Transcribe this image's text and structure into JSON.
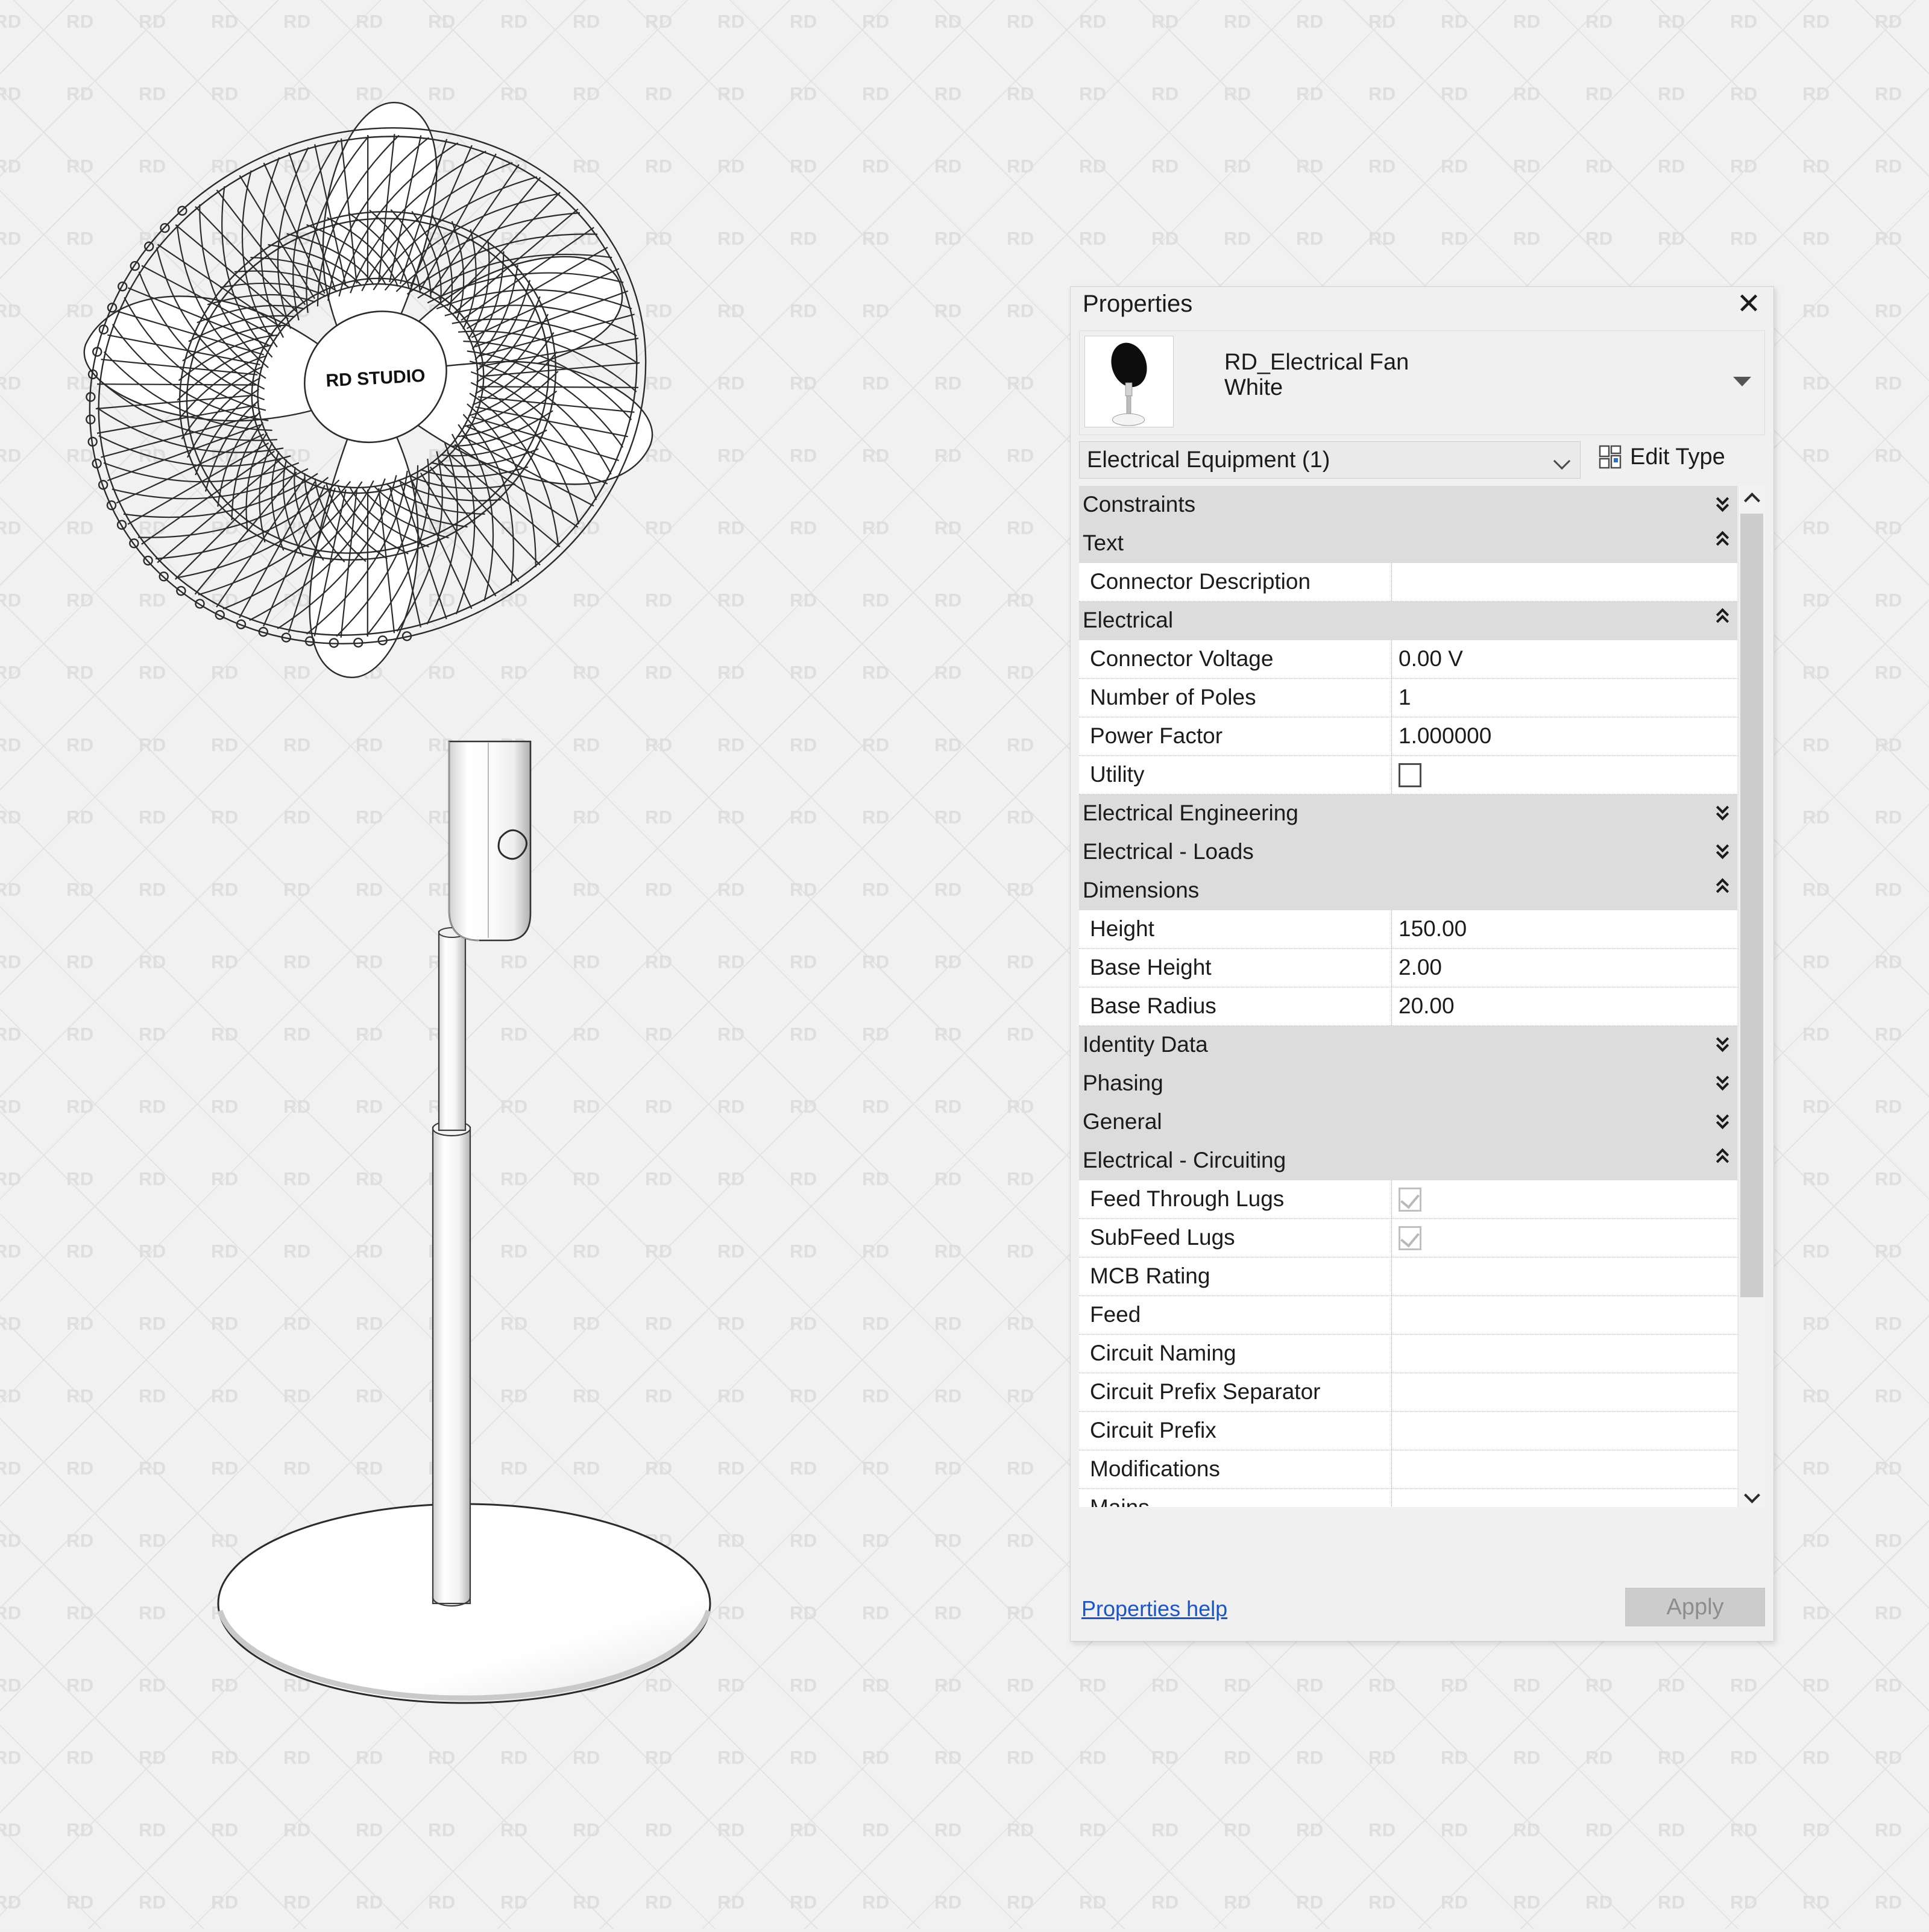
{
  "watermark": {
    "text": "RD"
  },
  "model": {
    "hub_label": "RD STUDIO"
  },
  "panel": {
    "title": "Properties",
    "close_icon": "close-icon",
    "type_name_line1": "RD_Electrical Fan",
    "type_name_line2": "White",
    "type_dropdown_icon": "chevron-down-icon",
    "selector_value": "Electrical Equipment (1)",
    "selector_caret_icon": "chevron-down-icon",
    "edit_type_label": "Edit Type",
    "edit_type_icon": "edit-type-icon",
    "footer": {
      "help_link": "Properties help",
      "apply_label": "Apply"
    },
    "scrollbar": {
      "up_icon": "chevron-up-icon",
      "down_icon": "chevron-down-icon"
    },
    "rows": [
      {
        "kind": "group",
        "label": "Constraints",
        "state": "collapsed"
      },
      {
        "kind": "group",
        "label": "Text",
        "state": "expanded"
      },
      {
        "kind": "prop",
        "label": "Connector Description",
        "value": ""
      },
      {
        "kind": "group",
        "label": "Electrical",
        "state": "expanded"
      },
      {
        "kind": "prop",
        "label": "Connector Voltage",
        "value": "0.00 V"
      },
      {
        "kind": "prop",
        "label": "Number of Poles",
        "value": "1"
      },
      {
        "kind": "prop",
        "label": "Power Factor",
        "value": "1.000000"
      },
      {
        "kind": "check",
        "label": "Utility",
        "checked": false,
        "dim": false
      },
      {
        "kind": "group",
        "label": "Electrical Engineering",
        "state": "collapsed"
      },
      {
        "kind": "group",
        "label": "Electrical - Loads",
        "state": "collapsed"
      },
      {
        "kind": "group",
        "label": "Dimensions",
        "state": "expanded"
      },
      {
        "kind": "prop",
        "label": "Height",
        "value": "150.00"
      },
      {
        "kind": "prop",
        "label": "Base Height",
        "value": "2.00"
      },
      {
        "kind": "prop",
        "label": "Base Radius",
        "value": "20.00"
      },
      {
        "kind": "group",
        "label": "Identity Data",
        "state": "collapsed"
      },
      {
        "kind": "group",
        "label": "Phasing",
        "state": "collapsed"
      },
      {
        "kind": "group",
        "label": "General",
        "state": "collapsed"
      },
      {
        "kind": "group",
        "label": "Electrical - Circuiting",
        "state": "expanded"
      },
      {
        "kind": "check",
        "label": "Feed Through Lugs",
        "checked": true,
        "dim": true
      },
      {
        "kind": "check",
        "label": "SubFeed Lugs",
        "checked": true,
        "dim": true
      },
      {
        "kind": "prop",
        "label": "MCB Rating",
        "value": ""
      },
      {
        "kind": "prop",
        "label": "Feed",
        "value": ""
      },
      {
        "kind": "prop",
        "label": "Circuit Naming",
        "value": ""
      },
      {
        "kind": "prop",
        "label": "Circuit Prefix Separator",
        "value": ""
      },
      {
        "kind": "prop",
        "label": "Circuit Prefix",
        "value": ""
      },
      {
        "kind": "prop",
        "label": "Modifications",
        "value": ""
      },
      {
        "kind": "prop",
        "label": "Mains",
        "value": ""
      }
    ]
  },
  "colors": {
    "background": "#f1f1f1",
    "panel_bg": "#f0f0f0",
    "group_row": "#dcdcdc",
    "row_bg": "#ffffff",
    "link": "#1a55cc",
    "apply_bg": "#cccccc",
    "watermark": "#dededd"
  }
}
